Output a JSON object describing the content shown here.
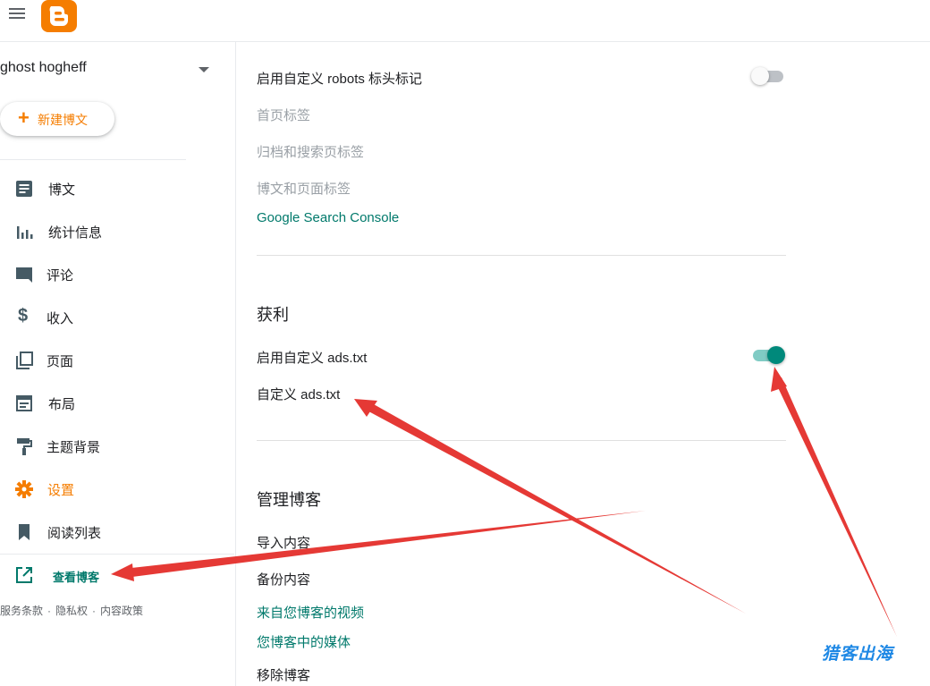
{
  "sidebar": {
    "blog_name": "ghost hogheff",
    "new_post_label": "新建博文",
    "items": [
      {
        "label": "博文",
        "icon": "document-icon"
      },
      {
        "label": "统计信息",
        "icon": "bar-chart-icon"
      },
      {
        "label": "评论",
        "icon": "comment-icon"
      },
      {
        "label": "收入",
        "icon": "dollar-icon"
      },
      {
        "label": "页面",
        "icon": "pages-icon"
      },
      {
        "label": "布局",
        "icon": "layout-icon"
      },
      {
        "label": "主题背景",
        "icon": "paint-roller-icon"
      },
      {
        "label": "设置",
        "icon": "gear-icon",
        "active": true
      },
      {
        "label": "阅读列表",
        "icon": "bookmark-icon"
      }
    ],
    "view_blog_label": "查看博客",
    "footer": {
      "terms": "服务条款",
      "privacy": "隐私权",
      "content_policy": "内容政策"
    }
  },
  "crawlers": {
    "custom_robots_header_label": "启用自定义 robots 标头标记",
    "custom_robots_header_enabled": false,
    "home_tags": "首页标签",
    "archive_search_tags": "归档和搜索页标签",
    "post_page_tags": "博文和页面标签",
    "search_console_link": "Google Search Console"
  },
  "monetization": {
    "title": "获利",
    "custom_ads_label": "启用自定义 ads.txt",
    "custom_ads_enabled": true,
    "custom_ads_txt": "自定义 ads.txt"
  },
  "manage_blog": {
    "title": "管理博客",
    "import_content": "导入内容",
    "backup_content": "备份内容",
    "videos_from_blog": "来自您博客的视频",
    "media_in_blog": "您博客中的媒体",
    "remove_blog": "移除博客"
  },
  "watermark": "猎客出海",
  "colors": {
    "brand": "#f57d00",
    "accent": "#00796b",
    "toggle_on": "#00897b",
    "annotation_arrow": "#e53935",
    "watermark": "#1e88e5"
  }
}
